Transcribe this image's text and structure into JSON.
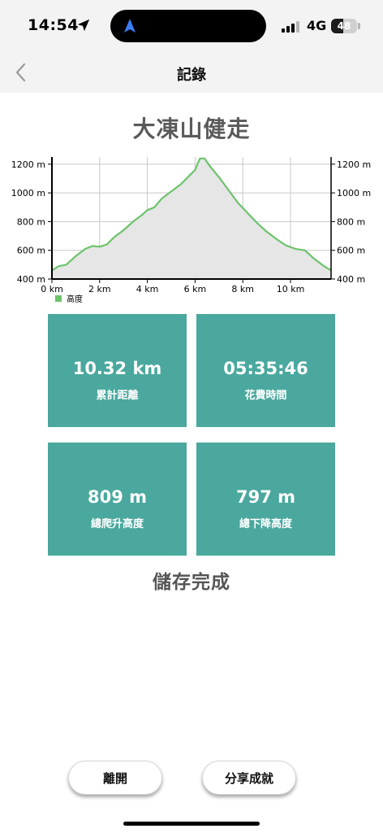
{
  "status_bar": {
    "time": "14:54",
    "network": "4G",
    "battery": "48",
    "battery_level": 0.48
  },
  "nav": {
    "title": "記錄"
  },
  "page_title": "大凍山健走",
  "chart_data": {
    "type": "area",
    "x_unit": "km",
    "xlim": [
      0,
      11.7
    ],
    "ylim": [
      400,
      1250
    ],
    "x_ticks": [
      "0 km",
      "2 km",
      "4 km",
      "6 km",
      "8 km",
      "10 km"
    ],
    "y_ticks": [
      "400 m",
      "600 m",
      "800 m",
      "1000 m",
      "1200 m"
    ],
    "x_tick_values": [
      0,
      2,
      4,
      6,
      8,
      10
    ],
    "y_tick_values": [
      400,
      600,
      800,
      1000,
      1200
    ],
    "grid": true,
    "legend_position": "bottom-left",
    "series": [
      {
        "name": "高度",
        "color": "#6cc36a",
        "fill": "#e6e6e6",
        "x": [
          0,
          0.3,
          0.6,
          1.0,
          1.4,
          1.7,
          2.0,
          2.3,
          2.6,
          3.0,
          3.4,
          3.8,
          4.0,
          4.3,
          4.6,
          5.0,
          5.4,
          5.7,
          6.0,
          6.2,
          6.4,
          6.6,
          7.0,
          7.4,
          7.8,
          8.2,
          8.6,
          9.0,
          9.4,
          9.8,
          10.2,
          10.6,
          11.0,
          11.4,
          11.7
        ],
        "y": [
          460,
          490,
          500,
          560,
          610,
          630,
          625,
          640,
          690,
          740,
          800,
          850,
          880,
          900,
          960,
          1010,
          1060,
          1110,
          1160,
          1240,
          1240,
          1190,
          1110,
          1020,
          930,
          860,
          790,
          730,
          680,
          635,
          610,
          600,
          540,
          490,
          460
        ]
      }
    ]
  },
  "stats": [
    {
      "value": "10.32 km",
      "label": "累計距離"
    },
    {
      "value": "05:35:46",
      "label": "花費時間"
    },
    {
      "value": "809 m",
      "label": "總爬升高度"
    },
    {
      "value": "797 m",
      "label": "總下降高度"
    }
  ],
  "tile_color": "#4aa89e",
  "save_status": "儲存完成",
  "buttons": {
    "leave": "離開",
    "share": "分享成就"
  }
}
